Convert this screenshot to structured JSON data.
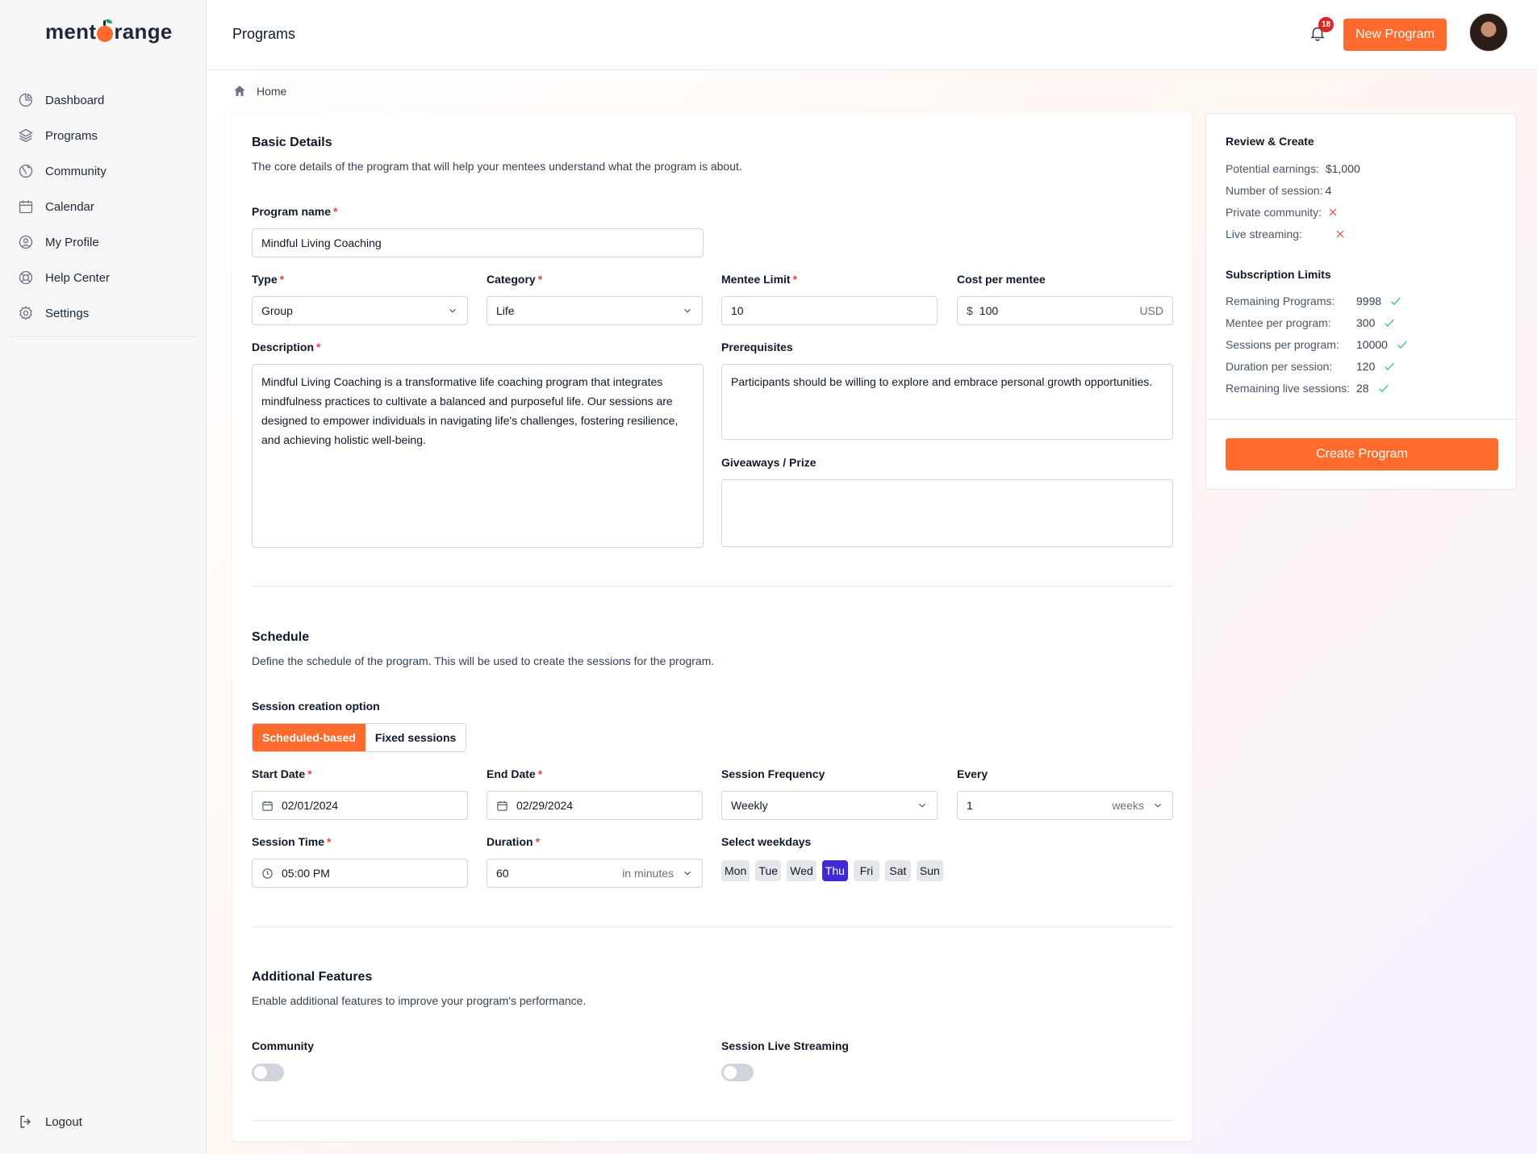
{
  "brand": {
    "name_prefix": "ment",
    "name_suffix": "range",
    "accent": "#ff6b2c"
  },
  "sidebar": {
    "items": [
      {
        "label": "Dashboard",
        "icon": "pie-chart-icon"
      },
      {
        "label": "Programs",
        "icon": "layers-icon"
      },
      {
        "label": "Community",
        "icon": "globe-icon"
      },
      {
        "label": "Calendar",
        "icon": "calendar-icon"
      },
      {
        "label": "My Profile",
        "icon": "user-circle-icon"
      },
      {
        "label": "Help Center",
        "icon": "lifebuoy-icon"
      },
      {
        "label": "Settings",
        "icon": "gear-icon"
      }
    ],
    "logout": "Logout"
  },
  "header": {
    "title": "Programs",
    "notifications": "18",
    "new_program": "New Program"
  },
  "breadcrumb": {
    "home": "Home"
  },
  "basic": {
    "title": "Basic Details",
    "subtitle": "The core details of the program that will help your mentees understand what the program is about.",
    "program_name_label": "Program name",
    "program_name": "Mindful Living Coaching",
    "type_label": "Type",
    "type": "Group",
    "category_label": "Category",
    "category": "Life",
    "mentee_limit_label": "Mentee Limit",
    "mentee_limit": "10",
    "cost_label": "Cost per mentee",
    "cost_currency_symbol": "$",
    "cost": "100",
    "cost_currency": "USD",
    "description_label": "Description",
    "description": "Mindful Living Coaching is a transformative life coaching program that integrates mindfulness practices to cultivate a balanced and purposeful life. Our sessions are designed to empower individuals in navigating life's challenges, fostering resilience, and achieving holistic well-being.",
    "prerequisites_label": "Prerequisites",
    "prerequisites": "Participants should be willing to explore and embrace personal growth opportunities.",
    "giveaways_label": "Giveaways / Prize",
    "giveaways": ""
  },
  "schedule": {
    "title": "Schedule",
    "subtitle": "Define the schedule of the program. This will be used to create the sessions for the program.",
    "session_option_label": "Session creation option",
    "options": [
      "Scheduled-based",
      "Fixed sessions"
    ],
    "start_date_label": "Start Date",
    "start_date": "02/01/2024",
    "end_date_label": "End Date",
    "end_date": "02/29/2024",
    "frequency_label": "Session Frequency",
    "frequency": "Weekly",
    "every_label": "Every",
    "every": "1",
    "every_unit": "weeks",
    "session_time_label": "Session Time",
    "session_time": "05:00 PM",
    "duration_label": "Duration",
    "duration": "60",
    "duration_unit": "in minutes",
    "weekdays_label": "Select weekdays",
    "weekdays": [
      "Mon",
      "Tue",
      "Wed",
      "Thu",
      "Fri",
      "Sat",
      "Sun"
    ],
    "selected_weekday": "Thu"
  },
  "features": {
    "title": "Additional Features",
    "subtitle": "Enable additional features to improve your program's performance.",
    "community_label": "Community",
    "streaming_label": "Session Live Streaming"
  },
  "review": {
    "title": "Review & Create",
    "earnings_label": "Potential earnings:",
    "earnings": "$1,000",
    "sessions_label": "Number of session:",
    "sessions": "4",
    "private_label": "Private community:",
    "streaming_label": "Live streaming:",
    "limits_title": "Subscription Limits",
    "limits": [
      {
        "label": "Remaining Programs:",
        "value": "9998"
      },
      {
        "label": "Mentee per program:",
        "value": "300"
      },
      {
        "label": "Sessions per program:",
        "value": "10000"
      },
      {
        "label": "Duration per session:",
        "value": "120"
      },
      {
        "label": "Remaining live sessions:",
        "value": "28"
      }
    ],
    "create": "Create Program"
  }
}
